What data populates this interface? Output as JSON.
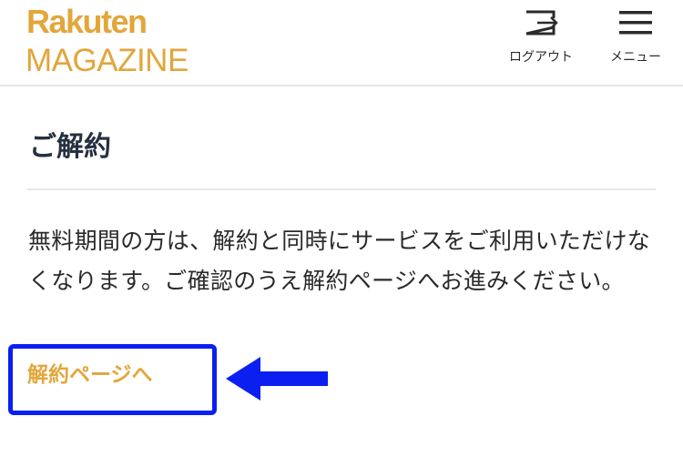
{
  "header": {
    "logo_top": "Rakuten",
    "logo_bottom": "MAGAZINE",
    "logout_label": "ログアウト",
    "menu_label": "メニュー",
    "logout_icon": "logout-icon",
    "menu_icon": "hamburger-menu-icon"
  },
  "main": {
    "title": "ご解約",
    "description": "無料期間の方は、解約と同時にサービスをご利用いただけなくなります。ご確認のうえ解約ページへお進みください。",
    "cancel_link": "解約ページへ"
  },
  "annotation": {
    "arrow_icon": "left-arrow-icon",
    "highlight_color": "#0a1ff0"
  },
  "colors": {
    "brand": "#e2a63b",
    "text": "#2a2a2a"
  }
}
